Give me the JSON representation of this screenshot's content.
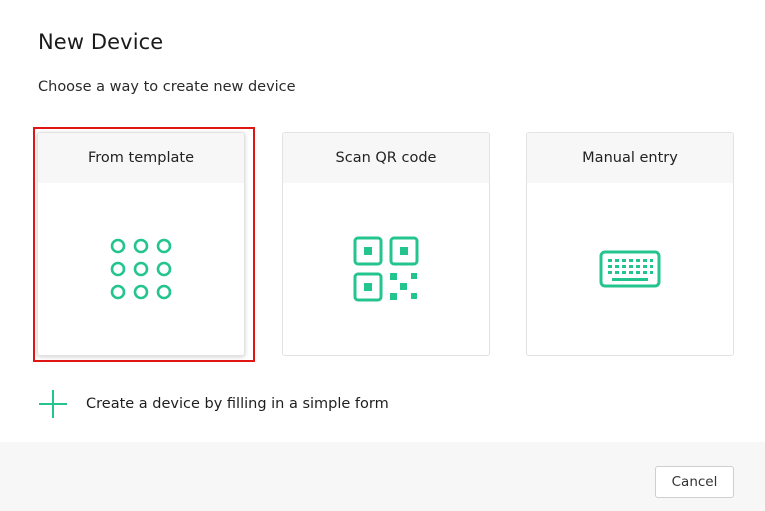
{
  "dialog": {
    "title": "New Device",
    "subtitle": "Choose a way to create new device"
  },
  "options": [
    {
      "label": "From template",
      "icon": "grid-icon",
      "selected": true
    },
    {
      "label": "Scan QR code",
      "icon": "qr-code-icon",
      "selected": false
    },
    {
      "label": "Manual entry",
      "icon": "keyboard-icon",
      "selected": false
    }
  ],
  "form_link": {
    "label": "Create a device by filling in a simple form",
    "icon": "plus-icon"
  },
  "footer": {
    "cancel_label": "Cancel"
  },
  "colors": {
    "accent": "#23c48e",
    "highlight": "#e01515",
    "card_header_bg": "#f7f7f7",
    "footer_bg": "#f7f7f7"
  }
}
